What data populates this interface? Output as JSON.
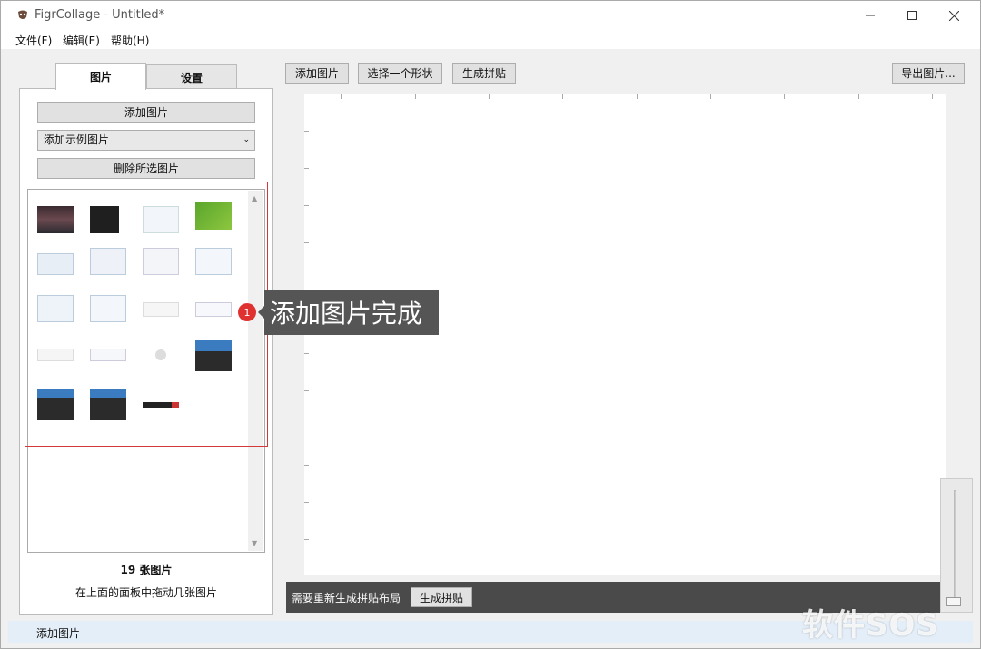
{
  "window": {
    "title": "FigrCollage - Untitled*"
  },
  "menu": {
    "file": "文件(F)",
    "edit": "编辑(E)",
    "help": "帮助(H)"
  },
  "tabs": {
    "images": "图片",
    "settings": "设置"
  },
  "left_panel": {
    "add_button": "添加图片",
    "sample_select": "添加示例图片",
    "delete_button": "删除所选图片",
    "count_label": "19 张图片",
    "hint_label": "在上面的面板中拖动几张图片"
  },
  "toolbar": {
    "add_images": "添加图片",
    "choose_shape": "选择一个形状",
    "generate": "生成拼贴",
    "export": "导出图片..."
  },
  "status_strip": {
    "message": "需要重新生成拼贴布局",
    "generate_button": "生成拼贴"
  },
  "callout": {
    "badge": "1",
    "text": "添加图片完成"
  },
  "statusbar": {
    "text": "添加图片"
  },
  "watermark": {
    "text": "软件SOS"
  },
  "colors": {
    "callout_bg": "#555555",
    "badge": "#e03131",
    "highlight_border": "#d23a3a",
    "status_strip": "#4a4a4a"
  }
}
